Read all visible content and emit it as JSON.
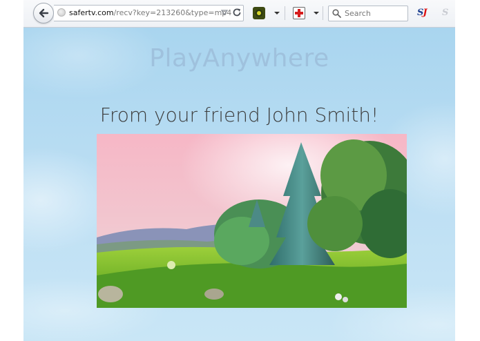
{
  "browser": {
    "url_domain": "safertv.com",
    "url_path": "/recv?key=213260&type=mp4",
    "search_placeholder": "Search"
  },
  "page": {
    "app_title": "PlayAnywhere",
    "message": "From your friend John Smith!"
  },
  "icons": {
    "back": "back-arrow-icon",
    "site": "globe-icon",
    "dropmark": "dropdown-triangle-icon",
    "reload": "reload-icon",
    "ext1": "camera-extension-icon",
    "ext2": "first-aid-extension-icon",
    "search": "magnifier-icon",
    "ext3": "s-logo-extension-icon",
    "ext4": "s-logo-disabled-icon"
  },
  "colors": {
    "page_background": "#bfe0f4",
    "title_color": "#9fc1dd",
    "message_color": "#3c3c3c"
  },
  "video": {
    "scene": "animated meadow with pine trees under a pink sky"
  }
}
